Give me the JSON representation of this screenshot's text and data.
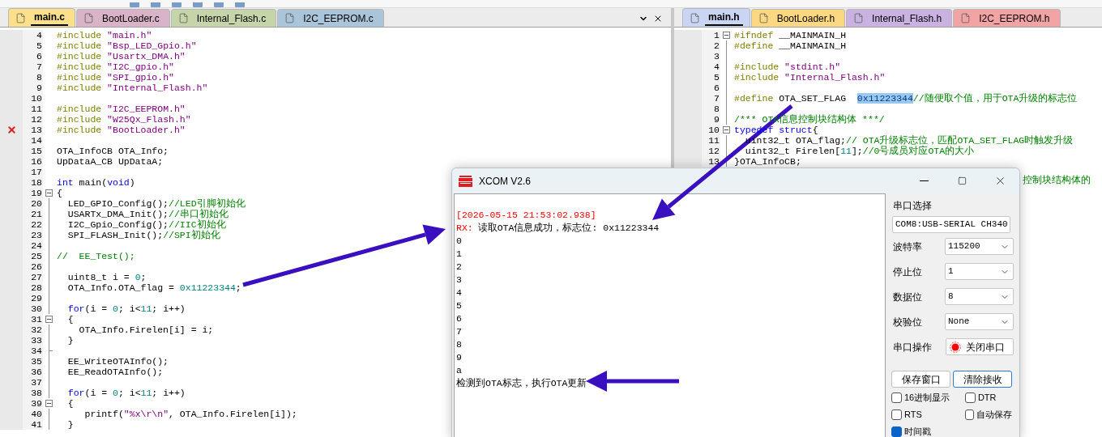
{
  "left_editor": {
    "tabs": [
      {
        "label": "main.c",
        "selected": true,
        "color": "#fde08c"
      },
      {
        "label": "BootLoader.c",
        "selected": false,
        "color": "#d9b3c8"
      },
      {
        "label": "Internal_Flash.c",
        "selected": false,
        "color": "#c6d4a9"
      },
      {
        "label": "I2C_EEPROM.c",
        "selected": false,
        "color": "#aac5d9"
      }
    ],
    "lines": [
      {
        "number": "4",
        "error": false,
        "kind": "plain",
        "tokens": [
          {
            "kind": "pp",
            "text": "#include"
          },
          {
            "kind": "str",
            "text": " \"main.h\""
          }
        ]
      },
      {
        "number": "5",
        "error": false,
        "kind": "plain",
        "tokens": [
          {
            "kind": "pp",
            "text": "#include"
          },
          {
            "kind": "str",
            "text": " \"Bsp_LED_Gpio.h\""
          }
        ]
      },
      {
        "number": "6",
        "error": false,
        "kind": "plain",
        "tokens": [
          {
            "kind": "pp",
            "text": "#include"
          },
          {
            "kind": "str",
            "text": " \"Usartx_DMA.h\""
          }
        ]
      },
      {
        "number": "7",
        "error": false,
        "kind": "plain",
        "tokens": [
          {
            "kind": "pp",
            "text": "#include"
          },
          {
            "kind": "str",
            "text": " \"I2C_gpio.h\""
          }
        ]
      },
      {
        "number": "8",
        "error": false,
        "kind": "plain",
        "tokens": [
          {
            "kind": "pp",
            "text": "#include"
          },
          {
            "kind": "str",
            "text": " \"SPI_gpio.h\""
          }
        ]
      },
      {
        "number": "9",
        "error": false,
        "kind": "plain",
        "tokens": [
          {
            "kind": "pp",
            "text": "#include"
          },
          {
            "kind": "str",
            "text": " \"Internal_Flash.h\""
          }
        ]
      },
      {
        "number": "10",
        "error": false,
        "kind": "plain"
      },
      {
        "number": "11",
        "error": false,
        "kind": "plain",
        "tokens": [
          {
            "kind": "pp",
            "text": "#include"
          },
          {
            "kind": "str",
            "text": " \"I2C_EEPROM.h\""
          }
        ]
      },
      {
        "number": "12",
        "error": false,
        "kind": "plain",
        "tokens": [
          {
            "kind": "pp",
            "text": "#include"
          },
          {
            "kind": "str",
            "text": " \"W25Qx_Flash.h\""
          }
        ]
      },
      {
        "number": "13",
        "error": true,
        "kind": "plain",
        "tokens": [
          {
            "kind": "pp",
            "text": "#include"
          },
          {
            "kind": "str",
            "text": " \"BootLoader.h\""
          }
        ]
      },
      {
        "number": "14",
        "error": false,
        "kind": "plain"
      },
      {
        "number": "15",
        "error": false,
        "kind": "plain",
        "tokens": [
          {
            "kind": "plain",
            "text": "OTA_InfoCB OTA_Info;"
          }
        ]
      },
      {
        "number": "16",
        "error": false,
        "kind": "plain",
        "tokens": [
          {
            "kind": "plain",
            "text": "UpDataA_CB UpDataA;"
          }
        ]
      },
      {
        "number": "17",
        "error": false,
        "kind": "plain"
      },
      {
        "number": "18",
        "error": false,
        "kind": "plain",
        "tokens": [
          {
            "kind": "kw",
            "text": "int"
          },
          {
            "kind": "plain",
            "text": " main("
          },
          {
            "kind": "kw",
            "text": "void"
          },
          {
            "kind": "plain",
            "text": ")"
          }
        ]
      },
      {
        "number": "19",
        "error": false,
        "kind": "fold_start",
        "tokens": [
          {
            "kind": "plain",
            "text": "{"
          }
        ]
      },
      {
        "number": "20",
        "error": false,
        "kind": "fold_line",
        "tokens": [
          {
            "kind": "plain",
            "text": "  LED_GPIO_Config();"
          },
          {
            "kind": "cm",
            "text": "//LED引脚初始化"
          }
        ]
      },
      {
        "number": "21",
        "error": false,
        "kind": "fold_line",
        "tokens": [
          {
            "kind": "plain",
            "text": "  USARTx_DMA_Init();"
          },
          {
            "kind": "cm",
            "text": "//串口初始化"
          }
        ]
      },
      {
        "number": "22",
        "error": false,
        "kind": "fold_line",
        "tokens": [
          {
            "kind": "plain",
            "text": "  I2C_Gpio_Config();"
          },
          {
            "kind": "cm",
            "text": "//IIC初始化"
          }
        ]
      },
      {
        "number": "23",
        "error": false,
        "kind": "fold_line",
        "tokens": [
          {
            "kind": "plain",
            "text": "  SPI_FLASH_Init();"
          },
          {
            "kind": "cm",
            "text": "//SPI初始化"
          }
        ]
      },
      {
        "number": "24",
        "error": false,
        "kind": "fold_line"
      },
      {
        "number": "25",
        "error": false,
        "kind": "fold_line",
        "tokens": [
          {
            "kind": "cm",
            "text": "//  EE_Test();"
          }
        ]
      },
      {
        "number": "26",
        "error": false,
        "kind": "fold_line"
      },
      {
        "number": "27",
        "error": false,
        "kind": "fold_line",
        "tokens": [
          {
            "kind": "plain",
            "text": "  uint8_t i = "
          },
          {
            "kind": "num",
            "text": "0"
          },
          {
            "kind": "plain",
            "text": ";"
          }
        ]
      },
      {
        "number": "28",
        "error": false,
        "kind": "fold_line",
        "tokens": [
          {
            "kind": "plain",
            "text": "  OTA_Info.OTA_flag = "
          },
          {
            "kind": "num",
            "text": "0x11223344"
          },
          {
            "kind": "plain",
            "text": ";"
          }
        ]
      },
      {
        "number": "29",
        "error": false,
        "kind": "fold_line"
      },
      {
        "number": "30",
        "error": false,
        "kind": "fold_line",
        "tokens": [
          {
            "kind": "kw",
            "text": "  for"
          },
          {
            "kind": "plain",
            "text": "(i = "
          },
          {
            "kind": "num",
            "text": "0"
          },
          {
            "kind": "plain",
            "text": "; i<"
          },
          {
            "kind": "num",
            "text": "11"
          },
          {
            "kind": "plain",
            "text": "; i++)"
          }
        ]
      },
      {
        "number": "31",
        "error": false,
        "kind": "fold_start",
        "tokens": [
          {
            "kind": "plain",
            "text": "  {"
          }
        ]
      },
      {
        "number": "32",
        "error": false,
        "kind": "fold_line",
        "tokens": [
          {
            "kind": "plain",
            "text": "    OTA_Info.Firelen[i] = i;"
          }
        ]
      },
      {
        "number": "33",
        "error": false,
        "kind": "fold_line",
        "tokens": [
          {
            "kind": "plain",
            "text": "  }"
          }
        ]
      },
      {
        "number": "34",
        "error": false,
        "kind": "fold_end"
      },
      {
        "number": "35",
        "error": false,
        "kind": "fold_line",
        "tokens": [
          {
            "kind": "plain",
            "text": "  EE_WriteOTAInfo();"
          }
        ]
      },
      {
        "number": "36",
        "error": false,
        "kind": "fold_line",
        "tokens": [
          {
            "kind": "plain",
            "text": "  EE_ReadOTAInfo();"
          }
        ]
      },
      {
        "number": "37",
        "error": false,
        "kind": "fold_line"
      },
      {
        "number": "38",
        "error": false,
        "kind": "fold_line",
        "tokens": [
          {
            "kind": "kw",
            "text": "  for"
          },
          {
            "kind": "plain",
            "text": "(i = "
          },
          {
            "kind": "num",
            "text": "0"
          },
          {
            "kind": "plain",
            "text": "; i<"
          },
          {
            "kind": "num",
            "text": "11"
          },
          {
            "kind": "plain",
            "text": "; i++)"
          }
        ]
      },
      {
        "number": "39",
        "error": false,
        "kind": "fold_start",
        "tokens": [
          {
            "kind": "plain",
            "text": "  {"
          }
        ]
      },
      {
        "number": "40",
        "error": false,
        "kind": "fold_line",
        "tokens": [
          {
            "kind": "plain",
            "text": "     printf("
          },
          {
            "kind": "str",
            "text": "\"%x\\r\\n\""
          },
          {
            "kind": "plain",
            "text": ", OTA_Info.Firelen[i]);"
          }
        ]
      },
      {
        "number": "41",
        "error": false,
        "kind": "fold_line",
        "tokens": [
          {
            "kind": "plain",
            "text": "  }"
          }
        ]
      }
    ]
  },
  "right_editor": {
    "tabs": [
      {
        "label": "main.h",
        "selected": true,
        "color": "#c9d5f2"
      },
      {
        "label": "BootLoader.h",
        "selected": false,
        "color": "#fcd882"
      },
      {
        "label": "Internal_Flash.h",
        "selected": false,
        "color": "#c9b2e2"
      },
      {
        "label": "I2C_EEPROM.h",
        "selected": false,
        "color": "#f2a3a3"
      }
    ],
    "lines": [
      {
        "number": "1",
        "kind": "fold_start",
        "tokens": [
          {
            "kind": "pp",
            "text": "#ifndef"
          },
          {
            "kind": "plain",
            "text": " __MAINMAIN_H"
          }
        ]
      },
      {
        "number": "2",
        "kind": "fold_line",
        "tokens": [
          {
            "kind": "pp",
            "text": "#define"
          },
          {
            "kind": "plain",
            "text": " __MAINMAIN_H"
          }
        ]
      },
      {
        "number": "3",
        "kind": "fold_line"
      },
      {
        "number": "4",
        "kind": "fold_line",
        "tokens": [
          {
            "kind": "pp",
            "text": "#include"
          },
          {
            "kind": "str",
            "text": " \"stdint.h\""
          }
        ]
      },
      {
        "number": "5",
        "kind": "fold_line",
        "tokens": [
          {
            "kind": "pp",
            "text": "#include"
          },
          {
            "kind": "str",
            "text": " \"Internal_Flash.h\""
          }
        ]
      },
      {
        "number": "6",
        "kind": "fold_line"
      },
      {
        "number": "7",
        "kind": "fold_line",
        "tokens": [
          {
            "kind": "pp",
            "text": "#define"
          },
          {
            "kind": "plain",
            "text": " OTA_SET_FLAG  "
          },
          {
            "kind": "sel",
            "text": "0x11223344"
          },
          {
            "kind": "cm",
            "text": "//随便取个值，用于OTA升级的标志位"
          }
        ]
      },
      {
        "number": "8",
        "kind": "fold_line"
      },
      {
        "number": "9",
        "kind": "fold_line",
        "tokens": [
          {
            "kind": "cm",
            "text": "/*** OTA信息控制块结构体 ***/"
          }
        ]
      },
      {
        "number": "10",
        "kind": "fold_start",
        "tokens": [
          {
            "kind": "kw",
            "text": "typedef"
          },
          {
            "kind": "kw",
            "text": " struct"
          },
          {
            "kind": "plain",
            "text": "{"
          }
        ]
      },
      {
        "number": "11",
        "kind": "fold_line",
        "tokens": [
          {
            "kind": "plain",
            "text": "  uint32_t OTA_flag;"
          },
          {
            "kind": "cm",
            "text": "// OTA升级标志位，匹配OTA_SET_FLAG时触发升级"
          }
        ]
      },
      {
        "number": "12",
        "kind": "fold_line",
        "tokens": [
          {
            "kind": "plain",
            "text": "  uint32_t Firelen["
          },
          {
            "kind": "num",
            "text": "11"
          },
          {
            "kind": "plain",
            "text": "];"
          },
          {
            "kind": "cm",
            "text": "//0号成员对应OTA的大小"
          }
        ]
      },
      {
        "number": "13",
        "kind": "fold_line",
        "tokens": [
          {
            "kind": "plain",
            "text": "}OTA_InfoCB;"
          }
        ]
      }
    ],
    "partial_line": "控制块结构体的"
  },
  "xcom": {
    "title": "XCOM V2.6",
    "receive": [
      {
        "kind": "timestamp",
        "text": "[2026-05-15 21:53:02.938]"
      },
      {
        "kind": "rx",
        "prefix": "RX:",
        "text": "读取OTA信息成功，标志位: 0x11223344"
      },
      {
        "kind": "plain",
        "text": "0"
      },
      {
        "kind": "plain",
        "text": "1"
      },
      {
        "kind": "plain",
        "text": "2"
      },
      {
        "kind": "plain",
        "text": "3"
      },
      {
        "kind": "plain",
        "text": "4"
      },
      {
        "kind": "plain",
        "text": "5"
      },
      {
        "kind": "plain",
        "text": "6"
      },
      {
        "kind": "plain",
        "text": "7"
      },
      {
        "kind": "plain",
        "text": "8"
      },
      {
        "kind": "plain",
        "text": "9"
      },
      {
        "kind": "plain",
        "text": "a"
      },
      {
        "kind": "plain",
        "text": "检测到OTA标志，执行OTA更新"
      }
    ],
    "port_label": "串口选择",
    "port_value": "COM8:USB-SERIAL CH340",
    "settings": [
      {
        "label": "波特率",
        "value": "115200"
      },
      {
        "label": "停止位",
        "value": "1"
      },
      {
        "label": "数据位",
        "value": "8"
      },
      {
        "label": "校验位",
        "value": "None"
      }
    ],
    "operation_label": "串口操作",
    "operation_button": "关闭串口",
    "buttons": [
      "保存窗口",
      "清除接收"
    ],
    "checkboxes": [
      {
        "label": "16进制显示",
        "checked": false
      },
      {
        "label": "DTR",
        "checked": false
      },
      {
        "label": "RTS",
        "checked": false
      },
      {
        "label": "自动保存",
        "checked": false
      },
      {
        "label": "时间戳",
        "checked": true
      }
    ]
  }
}
